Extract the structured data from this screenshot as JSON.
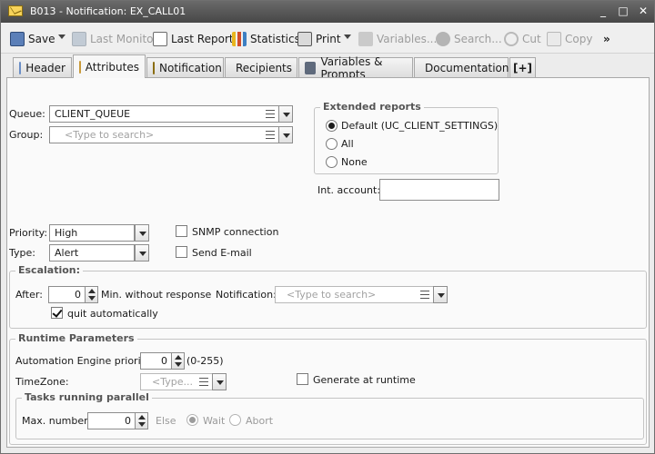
{
  "window": {
    "title": "B013 - Notification: EX_CALL01",
    "minimize": "_",
    "maximize": "□",
    "close": "✕"
  },
  "toolbar": {
    "save": "Save",
    "last_monitor": "Last Monitor",
    "last_report": "Last Report",
    "statistics": "Statistics",
    "print": "Print",
    "variables": "Variables...",
    "search": "Search...",
    "cut": "Cut",
    "copy": "Copy",
    "more": "»"
  },
  "tabs": [
    {
      "label": "Header",
      "icon": "header-icon"
    },
    {
      "label": "Attributes",
      "icon": "attributes-icon",
      "active": true
    },
    {
      "label": "Notification",
      "icon": "notification-icon"
    },
    {
      "label": "Recipients",
      "icon": "recipients-icon"
    },
    {
      "label": "Variables & Prompts",
      "icon": "variables-prompts-icon"
    },
    {
      "label": "Documentation",
      "icon": "documentation-icon"
    },
    {
      "label": "[+]",
      "icon": "add-tab-icon"
    }
  ],
  "attributes": {
    "queue_label": "Queue:",
    "queue_value": "CLIENT_QUEUE",
    "group_label": "Group:",
    "group_placeholder": "<Type to search>",
    "extended_reports": {
      "legend": "Extended reports",
      "options": [
        "Default (UC_CLIENT_SETTINGS)",
        "All",
        "None"
      ],
      "selected": "Default (UC_CLIENT_SETTINGS)"
    },
    "int_account_label": "Int. account:",
    "int_account_value": "",
    "priority_label": "Priority:",
    "priority_value": "High",
    "type_label": "Type:",
    "type_value": "Alert",
    "snmp_label": "SNMP connection",
    "snmp_checked": false,
    "send_email_label": "Send E-mail",
    "send_email_checked": false
  },
  "escalation": {
    "legend": "Escalation:",
    "after_label": "After:",
    "after_value": "0",
    "after_unit": "Min. without response",
    "notification_label": "Notification:",
    "notification_placeholder": "<Type to search>",
    "quit_label": "quit automatically",
    "quit_checked": true
  },
  "runtime": {
    "legend": "Runtime Parameters",
    "ae_priority_label": "Automation Engine priority:",
    "ae_priority_value": "0",
    "ae_priority_range": "(0-255)",
    "timezone_label": "TimeZone:",
    "timezone_placeholder": "<Type...",
    "generate_label": "Generate at runtime",
    "generate_checked": false,
    "tasks": {
      "legend": "Tasks running parallel",
      "max_label": "Max. number:",
      "max_value": "0",
      "else_label": "Else",
      "wait_label": "Wait",
      "abort_label": "Abort",
      "selected": "Wait"
    }
  }
}
